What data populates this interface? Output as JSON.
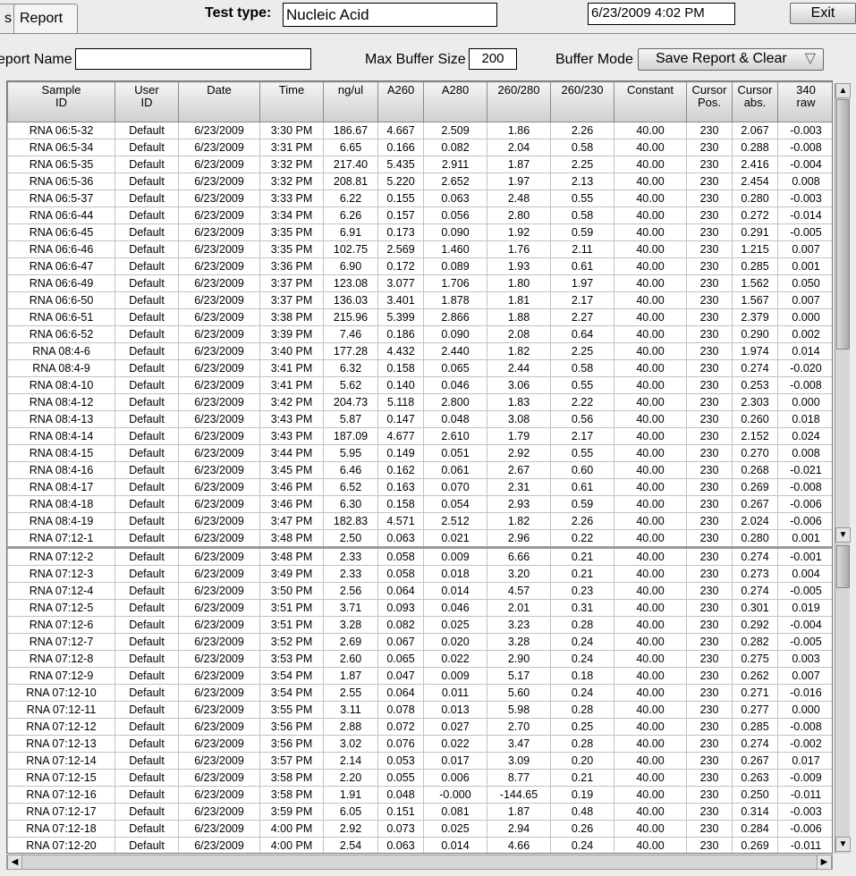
{
  "tabs": {
    "prev": "s",
    "active": "Report"
  },
  "header": {
    "test_type_label": "Test type:",
    "test_type_value": "Nucleic Acid",
    "datetime": "6/23/2009  4:02 PM",
    "exit_label": "Exit"
  },
  "options": {
    "report_name_label": "eport Name",
    "report_name_value": "",
    "max_buffer_label": "Max Buffer Size",
    "max_buffer_value": "200",
    "buffer_mode_label": "Buffer Mode",
    "buffer_mode_value": "Save Report & Clear"
  },
  "table": {
    "columns": [
      [
        "Sample",
        "ID"
      ],
      [
        "User",
        "ID"
      ],
      [
        "Date",
        ""
      ],
      [
        "Time",
        ""
      ],
      [
        "ng/ul",
        ""
      ],
      [
        "A260",
        ""
      ],
      [
        "A280",
        ""
      ],
      [
        "260/280",
        ""
      ],
      [
        "260/230",
        ""
      ],
      [
        "Constant",
        ""
      ],
      [
        "Cursor",
        "Pos."
      ],
      [
        "Cursor",
        "abs."
      ],
      [
        "340",
        "raw"
      ]
    ],
    "rows": [
      [
        "RNA 06:5-32",
        "Default",
        "6/23/2009",
        "3:30 PM",
        "186.67",
        "4.667",
        "2.509",
        "1.86",
        "2.26",
        "40.00",
        "230",
        "2.067",
        "-0.003"
      ],
      [
        "RNA 06:5-34",
        "Default",
        "6/23/2009",
        "3:31 PM",
        "6.65",
        "0.166",
        "0.082",
        "2.04",
        "0.58",
        "40.00",
        "230",
        "0.288",
        "-0.008"
      ],
      [
        "RNA 06:5-35",
        "Default",
        "6/23/2009",
        "3:32 PM",
        "217.40",
        "5.435",
        "2.911",
        "1.87",
        "2.25",
        "40.00",
        "230",
        "2.416",
        "-0.004"
      ],
      [
        "RNA 06:5-36",
        "Default",
        "6/23/2009",
        "3:32 PM",
        "208.81",
        "5.220",
        "2.652",
        "1.97",
        "2.13",
        "40.00",
        "230",
        "2.454",
        "0.008"
      ],
      [
        "RNA 06:5-37",
        "Default",
        "6/23/2009",
        "3:33 PM",
        "6.22",
        "0.155",
        "0.063",
        "2.48",
        "0.55",
        "40.00",
        "230",
        "0.280",
        "-0.003"
      ],
      [
        "RNA 06:6-44",
        "Default",
        "6/23/2009",
        "3:34 PM",
        "6.26",
        "0.157",
        "0.056",
        "2.80",
        "0.58",
        "40.00",
        "230",
        "0.272",
        "-0.014"
      ],
      [
        "RNA 06:6-45",
        "Default",
        "6/23/2009",
        "3:35 PM",
        "6.91",
        "0.173",
        "0.090",
        "1.92",
        "0.59",
        "40.00",
        "230",
        "0.291",
        "-0.005"
      ],
      [
        "RNA 06:6-46",
        "Default",
        "6/23/2009",
        "3:35 PM",
        "102.75",
        "2.569",
        "1.460",
        "1.76",
        "2.11",
        "40.00",
        "230",
        "1.215",
        "0.007"
      ],
      [
        "RNA 06:6-47",
        "Default",
        "6/23/2009",
        "3:36 PM",
        "6.90",
        "0.172",
        "0.089",
        "1.93",
        "0.61",
        "40.00",
        "230",
        "0.285",
        "0.001"
      ],
      [
        "RNA 06:6-49",
        "Default",
        "6/23/2009",
        "3:37 PM",
        "123.08",
        "3.077",
        "1.706",
        "1.80",
        "1.97",
        "40.00",
        "230",
        "1.562",
        "0.050"
      ],
      [
        "RNA 06:6-50",
        "Default",
        "6/23/2009",
        "3:37 PM",
        "136.03",
        "3.401",
        "1.878",
        "1.81",
        "2.17",
        "40.00",
        "230",
        "1.567",
        "0.007"
      ],
      [
        "RNA 06:6-51",
        "Default",
        "6/23/2009",
        "3:38 PM",
        "215.96",
        "5.399",
        "2.866",
        "1.88",
        "2.27",
        "40.00",
        "230",
        "2.379",
        "0.000"
      ],
      [
        "RNA 06:6-52",
        "Default",
        "6/23/2009",
        "3:39 PM",
        "7.46",
        "0.186",
        "0.090",
        "2.08",
        "0.64",
        "40.00",
        "230",
        "0.290",
        "0.002"
      ],
      [
        "RNA 08:4-6",
        "Default",
        "6/23/2009",
        "3:40 PM",
        "177.28",
        "4.432",
        "2.440",
        "1.82",
        "2.25",
        "40.00",
        "230",
        "1.974",
        "0.014"
      ],
      [
        "RNA 08:4-9",
        "Default",
        "6/23/2009",
        "3:41 PM",
        "6.32",
        "0.158",
        "0.065",
        "2.44",
        "0.58",
        "40.00",
        "230",
        "0.274",
        "-0.020"
      ],
      [
        "RNA 08:4-10",
        "Default",
        "6/23/2009",
        "3:41 PM",
        "5.62",
        "0.140",
        "0.046",
        "3.06",
        "0.55",
        "40.00",
        "230",
        "0.253",
        "-0.008"
      ],
      [
        "RNA 08:4-12",
        "Default",
        "6/23/2009",
        "3:42 PM",
        "204.73",
        "5.118",
        "2.800",
        "1.83",
        "2.22",
        "40.00",
        "230",
        "2.303",
        "0.000"
      ],
      [
        "RNA 08:4-13",
        "Default",
        "6/23/2009",
        "3:43 PM",
        "5.87",
        "0.147",
        "0.048",
        "3.08",
        "0.56",
        "40.00",
        "230",
        "0.260",
        "0.018"
      ],
      [
        "RNA 08:4-14",
        "Default",
        "6/23/2009",
        "3:43 PM",
        "187.09",
        "4.677",
        "2.610",
        "1.79",
        "2.17",
        "40.00",
        "230",
        "2.152",
        "0.024"
      ],
      [
        "RNA 08:4-15",
        "Default",
        "6/23/2009",
        "3:44 PM",
        "5.95",
        "0.149",
        "0.051",
        "2.92",
        "0.55",
        "40.00",
        "230",
        "0.270",
        "0.008"
      ],
      [
        "RNA 08:4-16",
        "Default",
        "6/23/2009",
        "3:45 PM",
        "6.46",
        "0.162",
        "0.061",
        "2.67",
        "0.60",
        "40.00",
        "230",
        "0.268",
        "-0.021"
      ],
      [
        "RNA 08:4-17",
        "Default",
        "6/23/2009",
        "3:46 PM",
        "6.52",
        "0.163",
        "0.070",
        "2.31",
        "0.61",
        "40.00",
        "230",
        "0.269",
        "-0.008"
      ],
      [
        "RNA 08:4-18",
        "Default",
        "6/23/2009",
        "3:46 PM",
        "6.30",
        "0.158",
        "0.054",
        "2.93",
        "0.59",
        "40.00",
        "230",
        "0.267",
        "-0.006"
      ],
      [
        "RNA 08:4-19",
        "Default",
        "6/23/2009",
        "3:47 PM",
        "182.83",
        "4.571",
        "2.512",
        "1.82",
        "2.26",
        "40.00",
        "230",
        "2.024",
        "-0.006"
      ],
      [
        "RNA 07:12-1",
        "Default",
        "6/23/2009",
        "3:48 PM",
        "2.50",
        "0.063",
        "0.021",
        "2.96",
        "0.22",
        "40.00",
        "230",
        "0.280",
        "0.001"
      ],
      [
        "RNA 07:12-2",
        "Default",
        "6/23/2009",
        "3:48 PM",
        "2.33",
        "0.058",
        "0.009",
        "6.66",
        "0.21",
        "40.00",
        "230",
        "0.274",
        "-0.001"
      ],
      [
        "RNA 07:12-3",
        "Default",
        "6/23/2009",
        "3:49 PM",
        "2.33",
        "0.058",
        "0.018",
        "3.20",
        "0.21",
        "40.00",
        "230",
        "0.273",
        "0.004"
      ],
      [
        "RNA 07:12-4",
        "Default",
        "6/23/2009",
        "3:50 PM",
        "2.56",
        "0.064",
        "0.014",
        "4.57",
        "0.23",
        "40.00",
        "230",
        "0.274",
        "-0.005"
      ],
      [
        "RNA 07:12-5",
        "Default",
        "6/23/2009",
        "3:51 PM",
        "3.71",
        "0.093",
        "0.046",
        "2.01",
        "0.31",
        "40.00",
        "230",
        "0.301",
        "0.019"
      ],
      [
        "RNA 07:12-6",
        "Default",
        "6/23/2009",
        "3:51 PM",
        "3.28",
        "0.082",
        "0.025",
        "3.23",
        "0.28",
        "40.00",
        "230",
        "0.292",
        "-0.004"
      ],
      [
        "RNA 07:12-7",
        "Default",
        "6/23/2009",
        "3:52 PM",
        "2.69",
        "0.067",
        "0.020",
        "3.28",
        "0.24",
        "40.00",
        "230",
        "0.282",
        "-0.005"
      ],
      [
        "RNA 07:12-8",
        "Default",
        "6/23/2009",
        "3:53 PM",
        "2.60",
        "0.065",
        "0.022",
        "2.90",
        "0.24",
        "40.00",
        "230",
        "0.275",
        "0.003"
      ],
      [
        "RNA 07:12-9",
        "Default",
        "6/23/2009",
        "3:54 PM",
        "1.87",
        "0.047",
        "0.009",
        "5.17",
        "0.18",
        "40.00",
        "230",
        "0.262",
        "0.007"
      ],
      [
        "RNA 07:12-10",
        "Default",
        "6/23/2009",
        "3:54 PM",
        "2.55",
        "0.064",
        "0.011",
        "5.60",
        "0.24",
        "40.00",
        "230",
        "0.271",
        "-0.016"
      ],
      [
        "RNA 07:12-11",
        "Default",
        "6/23/2009",
        "3:55 PM",
        "3.11",
        "0.078",
        "0.013",
        "5.98",
        "0.28",
        "40.00",
        "230",
        "0.277",
        "0.000"
      ],
      [
        "RNA 07:12-12",
        "Default",
        "6/23/2009",
        "3:56 PM",
        "2.88",
        "0.072",
        "0.027",
        "2.70",
        "0.25",
        "40.00",
        "230",
        "0.285",
        "-0.008"
      ],
      [
        "RNA 07:12-13",
        "Default",
        "6/23/2009",
        "3:56 PM",
        "3.02",
        "0.076",
        "0.022",
        "3.47",
        "0.28",
        "40.00",
        "230",
        "0.274",
        "-0.002"
      ],
      [
        "RNA 07:12-14",
        "Default",
        "6/23/2009",
        "3:57 PM",
        "2.14",
        "0.053",
        "0.017",
        "3.09",
        "0.20",
        "40.00",
        "230",
        "0.267",
        "0.017"
      ],
      [
        "RNA 07:12-15",
        "Default",
        "6/23/2009",
        "3:58 PM",
        "2.20",
        "0.055",
        "0.006",
        "8.77",
        "0.21",
        "40.00",
        "230",
        "0.263",
        "-0.009"
      ],
      [
        "RNA 07:12-16",
        "Default",
        "6/23/2009",
        "3:58 PM",
        "1.91",
        "0.048",
        "-0.000",
        "-144.65",
        "0.19",
        "40.00",
        "230",
        "0.250",
        "-0.011"
      ],
      [
        "RNA 07:12-17",
        "Default",
        "6/23/2009",
        "3:59 PM",
        "6.05",
        "0.151",
        "0.081",
        "1.87",
        "0.48",
        "40.00",
        "230",
        "0.314",
        "-0.003"
      ],
      [
        "RNA 07:12-18",
        "Default",
        "6/23/2009",
        "4:00 PM",
        "2.92",
        "0.073",
        "0.025",
        "2.94",
        "0.26",
        "40.00",
        "230",
        "0.284",
        "-0.006"
      ],
      [
        "RNA 07:12-20",
        "Default",
        "6/23/2009",
        "4:00 PM",
        "2.54",
        "0.063",
        "0.014",
        "4.66",
        "0.24",
        "40.00",
        "230",
        "0.269",
        "-0.011"
      ]
    ]
  },
  "icons": {
    "up": "▲",
    "down": "▼",
    "left": "◀",
    "right": "▶",
    "dropdown": "▽"
  }
}
